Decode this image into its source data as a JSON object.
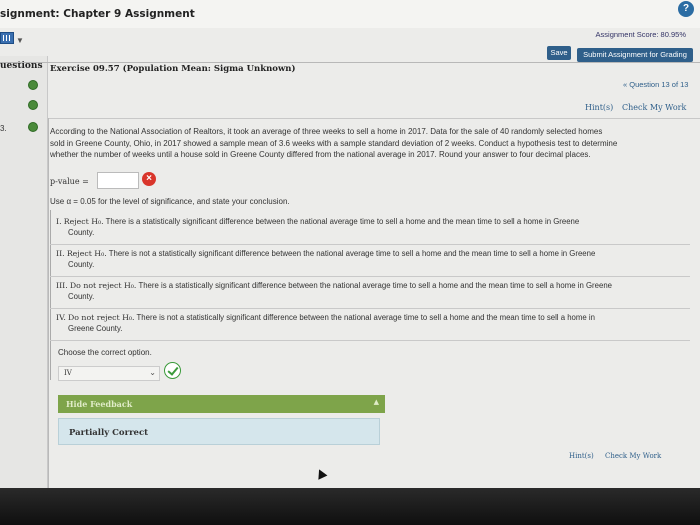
{
  "header": {
    "title": "signment: Chapter 9 Assignment",
    "help_icon": "?",
    "score": "Assignment Score: 80.95%",
    "save_label": "Save",
    "submit_label": "Submit Assignment for Grading"
  },
  "sidebar": {
    "label": "uestions",
    "items": [
      {
        "num": "",
        "status": "complete"
      },
      {
        "num": "",
        "status": "complete"
      },
      {
        "num": "3.",
        "status": "complete"
      }
    ]
  },
  "exercise": {
    "title": "Exercise 09.57 (Population Mean: Sigma Unknown)",
    "question_count": "« Question 13 of 13",
    "hint_label": "Hint(s)",
    "check_label": "Check My Work"
  },
  "problem": {
    "line1": "According to the National Association of Realtors, it took an average of three weeks to sell a home in 2017. Data for the sale of 40 randomly selected homes",
    "line2": "sold in Greene County, Ohio, in 2017 showed a sample mean of 3.6 weeks with a sample standard deviation of 2 weeks. Conduct a hypothesis test to determine",
    "line3": "whether the number of weeks until a house sold in Greene County differed from the national average in 2017. Round your answer to four decimal places.",
    "pvalue_label": "p-value =",
    "pvalue_value": "",
    "pvalue_status_icon": "×",
    "alpha_instruction": "Use α = 0.05 for the level of significance, and state your conclusion."
  },
  "options": [
    {
      "prefix": "I.",
      "verb": "Reject H₀.",
      "text": "There is a statistically significant difference between the national average time to sell a home and the mean time to sell a home in Greene",
      "cont": "County."
    },
    {
      "prefix": "II.",
      "verb": "Reject H₀.",
      "text": "There is not a statistically significant difference between the national average time to sell a home and the mean time to sell a home in Greene",
      "cont": "County."
    },
    {
      "prefix": "III.",
      "verb": "Do not reject H₀.",
      "text": "There is a statistically significant difference between the national average time to sell a home and the mean time to sell a home in Greene",
      "cont": "County."
    },
    {
      "prefix": "IV.",
      "verb": "Do not reject H₀.",
      "text": "There is not a statistically significant difference between the national average time to sell a home and the mean time to sell a home in",
      "cont": "Greene County."
    }
  ],
  "answer": {
    "choose_label": "Choose the correct option.",
    "selected": "IV",
    "selected_status_icon": "check"
  },
  "feedback": {
    "toggle_label": "Hide Feedback",
    "result": "Partially Correct"
  },
  "footer": {
    "hint_label": "Hint(s)",
    "check_label": "Check My Work"
  },
  "colors": {
    "accent": "#2f5f8a",
    "feedback_green": "#7ea44a",
    "feedback_body": "#d5e6ec",
    "error_red": "#d9352b",
    "ok_green": "#3a9a3a"
  }
}
